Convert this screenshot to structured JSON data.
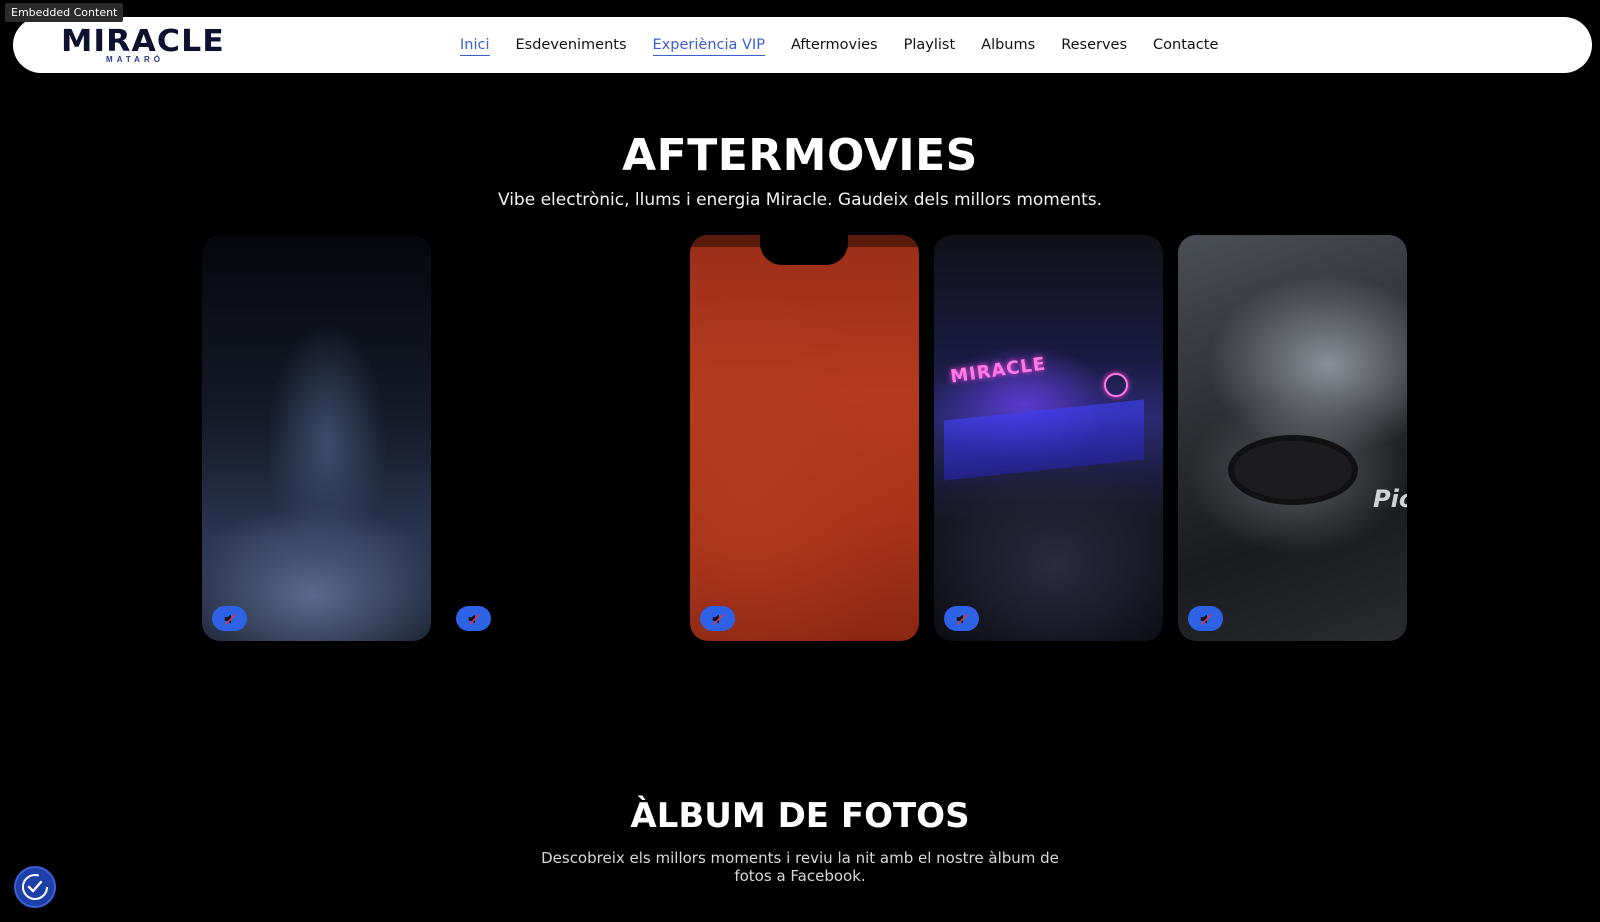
{
  "embed_tag": "Embedded Content",
  "logo": {
    "word": "MIRACLE",
    "sub": "MATARÓ"
  },
  "nav": {
    "items": [
      {
        "label": "Inici",
        "active": true
      },
      {
        "label": "Esdeveniments",
        "active": false
      },
      {
        "label": "Experiència VIP",
        "active": true
      },
      {
        "label": "Aftermovies",
        "active": false
      },
      {
        "label": "Playlist",
        "active": false
      },
      {
        "label": "Albums",
        "active": false
      },
      {
        "label": "Reserves",
        "active": false
      },
      {
        "label": "Contacte",
        "active": false
      }
    ]
  },
  "aftermovies": {
    "title": "AFTERMOVIES",
    "subtitle": "Vibe electrònic, llums i energia Miracle. Gaudeix dels millors moments.",
    "video_neon_text": "MIRACLE",
    "video_deck_text": "Pio"
  },
  "album": {
    "title": "ÀLBUM DE FOTOS",
    "subtitle": "Descobreix els millors moments i reviu la nit amb el nostre àlbum de fotos a Facebook."
  },
  "colors": {
    "accent": "#3a5ed0",
    "mute_button": "#2e62e6",
    "background": "#000000"
  },
  "icons": {
    "mute": "speaker-muted-icon",
    "accessibility": "accessibility-icon"
  }
}
